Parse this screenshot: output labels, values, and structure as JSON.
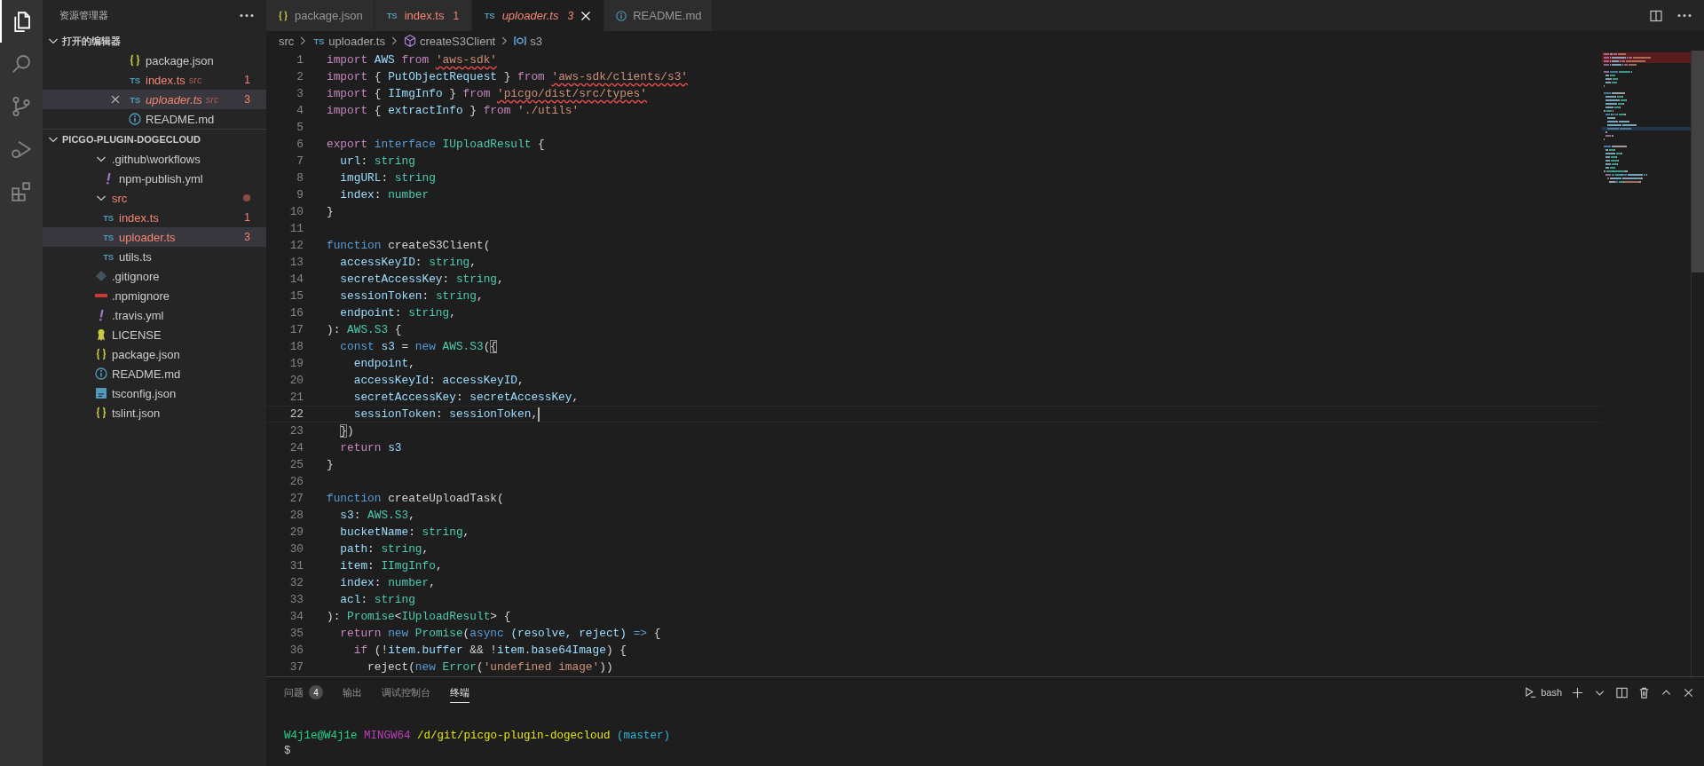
{
  "activity_bar": {
    "items": [
      {
        "kind": "files",
        "selected": true
      },
      {
        "kind": "search",
        "selected": false
      },
      {
        "kind": "source-control",
        "selected": false
      },
      {
        "kind": "debug",
        "selected": false
      },
      {
        "kind": "extensions",
        "selected": false
      }
    ]
  },
  "sidebar": {
    "title": "资源管理器",
    "sections": [
      {
        "title": "打开的编辑器",
        "expanded": true,
        "items": [
          {
            "label": "package.json",
            "kind": "json",
            "selected": false,
            "preview": false,
            "has_errors": false
          },
          {
            "label": "index.ts",
            "kind": "ts",
            "icon_text": "TS",
            "description": "src",
            "badge": "1",
            "selected": false,
            "preview": false,
            "has_errors": true
          },
          {
            "label": "uploader.ts",
            "kind": "ts",
            "icon_text": "TS",
            "description": "src",
            "badge": "3",
            "selected": true,
            "preview": true,
            "has_errors": true
          },
          {
            "label": "README.md",
            "kind": "info",
            "selected": false,
            "preview": false,
            "has_errors": false
          }
        ]
      },
      {
        "title": "PICGO-PLUGIN-DOGECLOUD",
        "expanded": true,
        "items": [
          {
            "kind": "folder",
            "label": ".github\\workflows",
            "expanded": true,
            "selected": false,
            "has_errors": false,
            "children": [
              {
                "kind": "yaml",
                "label": "npm-publish.yml",
                "selected": false,
                "has_errors": false
              }
            ]
          },
          {
            "kind": "folder",
            "label": "src",
            "expanded": true,
            "selected": false,
            "has_errors": true,
            "children": [
              {
                "kind": "ts",
                "label": "index.ts",
                "icon_text": "TS",
                "badge": "1",
                "selected": false,
                "has_errors": true
              },
              {
                "kind": "ts",
                "label": "uploader.ts",
                "icon_text": "TS",
                "badge": "3",
                "selected": true,
                "has_errors": true
              },
              {
                "kind": "ts",
                "label": "utils.ts",
                "icon_text": "TS",
                "selected": false,
                "has_errors": false
              }
            ]
          },
          {
            "kind": "git",
            "label": ".gitignore",
            "selected": false,
            "has_errors": false
          },
          {
            "kind": "npm",
            "label": ".npmignore",
            "selected": false,
            "has_errors": false
          },
          {
            "kind": "yaml",
            "label": ".travis.yml",
            "selected": false,
            "has_errors": false
          },
          {
            "kind": "license",
            "label": "LICENSE",
            "selected": false,
            "has_errors": false
          },
          {
            "kind": "json",
            "label": "package.json",
            "selected": false,
            "has_errors": false
          },
          {
            "kind": "info",
            "label": "README.md",
            "selected": false,
            "has_errors": false
          },
          {
            "kind": "tsconfig",
            "label": "tsconfig.json",
            "selected": false,
            "has_errors": false
          },
          {
            "kind": "json",
            "label": "tslint.json",
            "selected": false,
            "has_errors": false
          }
        ]
      }
    ]
  },
  "editor": {
    "tabs": [
      {
        "label": "package.json",
        "kind": "json",
        "selected": false,
        "preview": false,
        "has_errors": false
      },
      {
        "label": "index.ts",
        "kind": "ts",
        "icon_text": "TS",
        "badge": "1",
        "selected": false,
        "preview": false,
        "has_errors": true
      },
      {
        "label": "uploader.ts",
        "kind": "ts",
        "icon_text": "TS",
        "badge": "3",
        "selected": true,
        "preview": true,
        "has_errors": true
      },
      {
        "label": "README.md",
        "kind": "info",
        "selected": false,
        "preview": false,
        "has_errors": false
      }
    ],
    "breadcrumbs": [
      {
        "label": "src"
      },
      {
        "label": "uploader.ts",
        "kind": "ts",
        "icon_text": "TS"
      },
      {
        "label": "createS3Client",
        "kind": "function"
      },
      {
        "label": "s3",
        "kind": "variable"
      }
    ],
    "lines": [
      {
        "number": "1",
        "tokens": [
          {
            "text": "import ",
            "kind": "kw"
          },
          {
            "text": "AWS ",
            "kind": "var"
          },
          {
            "text": "from ",
            "kind": "kw"
          },
          {
            "text": "'aws-sdk'",
            "kind": "err"
          }
        ]
      },
      {
        "number": "2",
        "tokens": [
          {
            "text": "import ",
            "kind": "kw"
          },
          {
            "text": "{ ",
            "kind": "p"
          },
          {
            "text": "PutObjectRequest",
            "kind": "var"
          },
          {
            "text": " } ",
            "kind": "p"
          },
          {
            "text": "from ",
            "kind": "kw"
          },
          {
            "text": "'aws-sdk/clients/s3'",
            "kind": "err"
          }
        ]
      },
      {
        "number": "3",
        "tokens": [
          {
            "text": "import ",
            "kind": "kw"
          },
          {
            "text": "{ ",
            "kind": "p"
          },
          {
            "text": "IImgInfo",
            "kind": "var"
          },
          {
            "text": " } ",
            "kind": "p"
          },
          {
            "text": "from ",
            "kind": "kw"
          },
          {
            "text": "'picgo/dist/src/types'",
            "kind": "err"
          }
        ]
      },
      {
        "number": "4",
        "tokens": [
          {
            "text": "import ",
            "kind": "kw"
          },
          {
            "text": "{ ",
            "kind": "p"
          },
          {
            "text": "extractInfo",
            "kind": "var"
          },
          {
            "text": " } ",
            "kind": "p"
          },
          {
            "text": "from ",
            "kind": "kw"
          },
          {
            "text": "'./utils'",
            "kind": "str"
          }
        ]
      },
      {
        "number": "5"
      },
      {
        "number": "6",
        "tokens": [
          {
            "text": "export ",
            "kind": "kw"
          },
          {
            "text": "interface ",
            "kind": "st"
          },
          {
            "text": "IUploadResult",
            "kind": "type"
          },
          {
            "text": " {",
            "kind": "p"
          }
        ]
      },
      {
        "number": "7",
        "tokens": [
          {
            "text": "  url",
            "kind": "var"
          },
          {
            "text": ": ",
            "kind": "p"
          },
          {
            "text": "string",
            "kind": "type"
          }
        ]
      },
      {
        "number": "8",
        "tokens": [
          {
            "text": "  imgURL",
            "kind": "var"
          },
          {
            "text": ": ",
            "kind": "p"
          },
          {
            "text": "string",
            "kind": "type"
          }
        ]
      },
      {
        "number": "9",
        "tokens": [
          {
            "text": "  index",
            "kind": "var"
          },
          {
            "text": ": ",
            "kind": "p"
          },
          {
            "text": "number",
            "kind": "type"
          }
        ]
      },
      {
        "number": "10",
        "tokens": [
          {
            "text": "}",
            "kind": "p"
          }
        ]
      },
      {
        "number": "11"
      },
      {
        "number": "12",
        "tokens": [
          {
            "text": "function",
            "kind": "st"
          },
          {
            "text": " createS3Client(",
            "kind": "p"
          }
        ]
      },
      {
        "number": "13",
        "tokens": [
          {
            "text": "  accessKeyID",
            "kind": "var"
          },
          {
            "text": ": ",
            "kind": "p"
          },
          {
            "text": "string",
            "kind": "type"
          },
          {
            "text": ",",
            "kind": "p"
          }
        ]
      },
      {
        "number": "14",
        "tokens": [
          {
            "text": "  secretAccessKey",
            "kind": "var"
          },
          {
            "text": ": ",
            "kind": "p"
          },
          {
            "text": "string",
            "kind": "type"
          },
          {
            "text": ",",
            "kind": "p"
          }
        ]
      },
      {
        "number": "15",
        "tokens": [
          {
            "text": "  sessionToken",
            "kind": "var"
          },
          {
            "text": ": ",
            "kind": "p"
          },
          {
            "text": "string",
            "kind": "type"
          },
          {
            "text": ",",
            "kind": "p"
          }
        ]
      },
      {
        "number": "16",
        "tokens": [
          {
            "text": "  endpoint",
            "kind": "var"
          },
          {
            "text": ": ",
            "kind": "p"
          },
          {
            "text": "string",
            "kind": "type"
          },
          {
            "text": ",",
            "kind": "p"
          }
        ]
      },
      {
        "number": "17",
        "tokens": [
          {
            "text": "): ",
            "kind": "p"
          },
          {
            "text": "AWS.S3",
            "kind": "type"
          },
          {
            "text": " {",
            "kind": "p"
          }
        ]
      },
      {
        "number": "18",
        "tokens": [
          {
            "text": "  const",
            "kind": "st"
          },
          {
            "text": " s3 ",
            "kind": "var"
          },
          {
            "text": "= ",
            "kind": "p"
          },
          {
            "text": "new ",
            "kind": "st"
          },
          {
            "text": "AWS.S3",
            "kind": "type"
          },
          {
            "text": "(",
            "kind": "p"
          },
          {
            "text": "{",
            "kind": "match"
          }
        ]
      },
      {
        "number": "19",
        "tokens": [
          {
            "text": "    endpoint",
            "kind": "var"
          },
          {
            "text": ",",
            "kind": "p"
          }
        ]
      },
      {
        "number": "20",
        "tokens": [
          {
            "text": "    accessKeyId",
            "kind": "var"
          },
          {
            "text": ": ",
            "kind": "p"
          },
          {
            "text": "accessKeyID",
            "kind": "var"
          },
          {
            "text": ",",
            "kind": "p"
          }
        ]
      },
      {
        "number": "21",
        "tokens": [
          {
            "text": "    secretAccessKey",
            "kind": "var"
          },
          {
            "text": ": ",
            "kind": "p"
          },
          {
            "text": "secretAccessKey",
            "kind": "var"
          },
          {
            "text": ",",
            "kind": "p"
          }
        ]
      },
      {
        "number": "22",
        "current": true,
        "tokens": [
          {
            "text": "    sessionToken",
            "kind": "var"
          },
          {
            "text": ": ",
            "kind": "p"
          },
          {
            "text": "sessionToken",
            "kind": "var"
          },
          {
            "text": ",",
            "kind": "p"
          }
        ]
      },
      {
        "number": "23",
        "tokens": [
          {
            "text": "  }",
            "kind": "match"
          },
          {
            "text": ")",
            "kind": "p"
          }
        ]
      },
      {
        "number": "24",
        "tokens": [
          {
            "text": "  return",
            "kind": "kw"
          },
          {
            "text": " s3",
            "kind": "var"
          }
        ]
      },
      {
        "number": "25",
        "tokens": [
          {
            "text": "}",
            "kind": "p"
          }
        ]
      },
      {
        "number": "26"
      },
      {
        "number": "27",
        "tokens": [
          {
            "text": "function",
            "kind": "st"
          },
          {
            "text": " createUploadTask(",
            "kind": "p"
          }
        ]
      },
      {
        "number": "28",
        "tokens": [
          {
            "text": "  s3",
            "kind": "var"
          },
          {
            "text": ": ",
            "kind": "p"
          },
          {
            "text": "AWS.S3",
            "kind": "type"
          },
          {
            "text": ",",
            "kind": "p"
          }
        ]
      },
      {
        "number": "29",
        "tokens": [
          {
            "text": "  bucketName",
            "kind": "var"
          },
          {
            "text": ": ",
            "kind": "p"
          },
          {
            "text": "string",
            "kind": "type"
          },
          {
            "text": ",",
            "kind": "p"
          }
        ]
      },
      {
        "number": "30",
        "tokens": [
          {
            "text": "  path",
            "kind": "var"
          },
          {
            "text": ": ",
            "kind": "p"
          },
          {
            "text": "string",
            "kind": "type"
          },
          {
            "text": ",",
            "kind": "p"
          }
        ]
      },
      {
        "number": "31",
        "tokens": [
          {
            "text": "  item",
            "kind": "var"
          },
          {
            "text": ": ",
            "kind": "p"
          },
          {
            "text": "IImgInfo",
            "kind": "type"
          },
          {
            "text": ",",
            "kind": "p"
          }
        ]
      },
      {
        "number": "32",
        "tokens": [
          {
            "text": "  index",
            "kind": "var"
          },
          {
            "text": ": ",
            "kind": "p"
          },
          {
            "text": "number",
            "kind": "type"
          },
          {
            "text": ",",
            "kind": "p"
          }
        ]
      },
      {
        "number": "33",
        "tokens": [
          {
            "text": "  acl",
            "kind": "var"
          },
          {
            "text": ": ",
            "kind": "p"
          },
          {
            "text": "string",
            "kind": "type"
          }
        ]
      },
      {
        "number": "34",
        "tokens": [
          {
            "text": "): ",
            "kind": "p"
          },
          {
            "text": "Promise",
            "kind": "type"
          },
          {
            "text": "<",
            "kind": "p"
          },
          {
            "text": "IUploadResult",
            "kind": "type"
          },
          {
            "text": "> {",
            "kind": "p"
          }
        ]
      },
      {
        "number": "35",
        "tokens": [
          {
            "text": "  return",
            "kind": "kw"
          },
          {
            "text": " new ",
            "kind": "st"
          },
          {
            "text": "Promise",
            "kind": "type"
          },
          {
            "text": "(",
            "kind": "p"
          },
          {
            "text": "async",
            "kind": "st"
          },
          {
            "text": " (resolve, reject) ",
            "kind": "var"
          },
          {
            "text": "=>",
            "kind": "st"
          },
          {
            "text": " {",
            "kind": "p"
          }
        ]
      },
      {
        "number": "36",
        "tokens": [
          {
            "text": "    if",
            "kind": "kw"
          },
          {
            "text": " (!",
            "kind": "p"
          },
          {
            "text": "item.buffer",
            "kind": "var"
          },
          {
            "text": " && !",
            "kind": "p"
          },
          {
            "text": "item.base64Image",
            "kind": "var"
          },
          {
            "text": ") {",
            "kind": "p"
          }
        ]
      },
      {
        "number": "37",
        "tokens": [
          {
            "text": "      reject(",
            "kind": "p"
          },
          {
            "text": "new ",
            "kind": "st"
          },
          {
            "text": "Error",
            "kind": "type"
          },
          {
            "text": "(",
            "kind": "p"
          },
          {
            "text": "'undefined image'",
            "kind": "str"
          },
          {
            "text": "))",
            "kind": "p"
          }
        ]
      }
    ]
  },
  "panel": {
    "tabs": [
      {
        "label": "问题",
        "badge": "4",
        "selected": false
      },
      {
        "label": "输出",
        "selected": false
      },
      {
        "label": "调试控制台",
        "selected": false
      },
      {
        "label": "终端",
        "selected": true
      }
    ],
    "terminal": {
      "shell": "bash",
      "lines": [
        {
          "segments": [
            {
              "text": "W4j1e@W4j1e ",
              "kind": "green"
            },
            {
              "text": "MINGW64 ",
              "kind": "purple"
            },
            {
              "text": "/d/git/picgo-plugin-dogecloud ",
              "kind": "yellow"
            },
            {
              "text": "(master)",
              "kind": "blue"
            }
          ]
        },
        {
          "segments": [
            {
              "text": "$",
              "kind": "plain"
            }
          ]
        }
      ]
    }
  }
}
